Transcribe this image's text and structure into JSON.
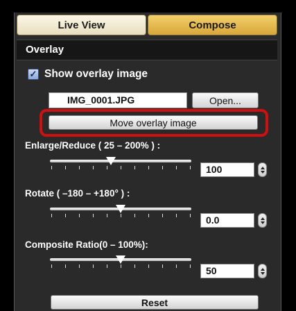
{
  "tabs": {
    "live_view": "Live View",
    "compose": "Compose"
  },
  "overlay": {
    "header": "Overlay",
    "show_overlay_label": "Show overlay image",
    "show_overlay_checked": true,
    "filename": "IMG_0001.JPG",
    "open_button": "Open...",
    "move_button": "Move overlay image"
  },
  "enlarge": {
    "label": "Enlarge/Reduce ( 25 – 200% ) :",
    "value": "100"
  },
  "rotate": {
    "label": "Rotate ( –180 – +180° ) :",
    "value": "0.0"
  },
  "composite": {
    "label": "Composite Ratio(0 – 100%):",
    "value": "50"
  },
  "reset_button": "Reset",
  "colors": {
    "compose_tab": "#e2b548",
    "highlight": "#d01010",
    "panel_bg": "#2a2a2a"
  }
}
